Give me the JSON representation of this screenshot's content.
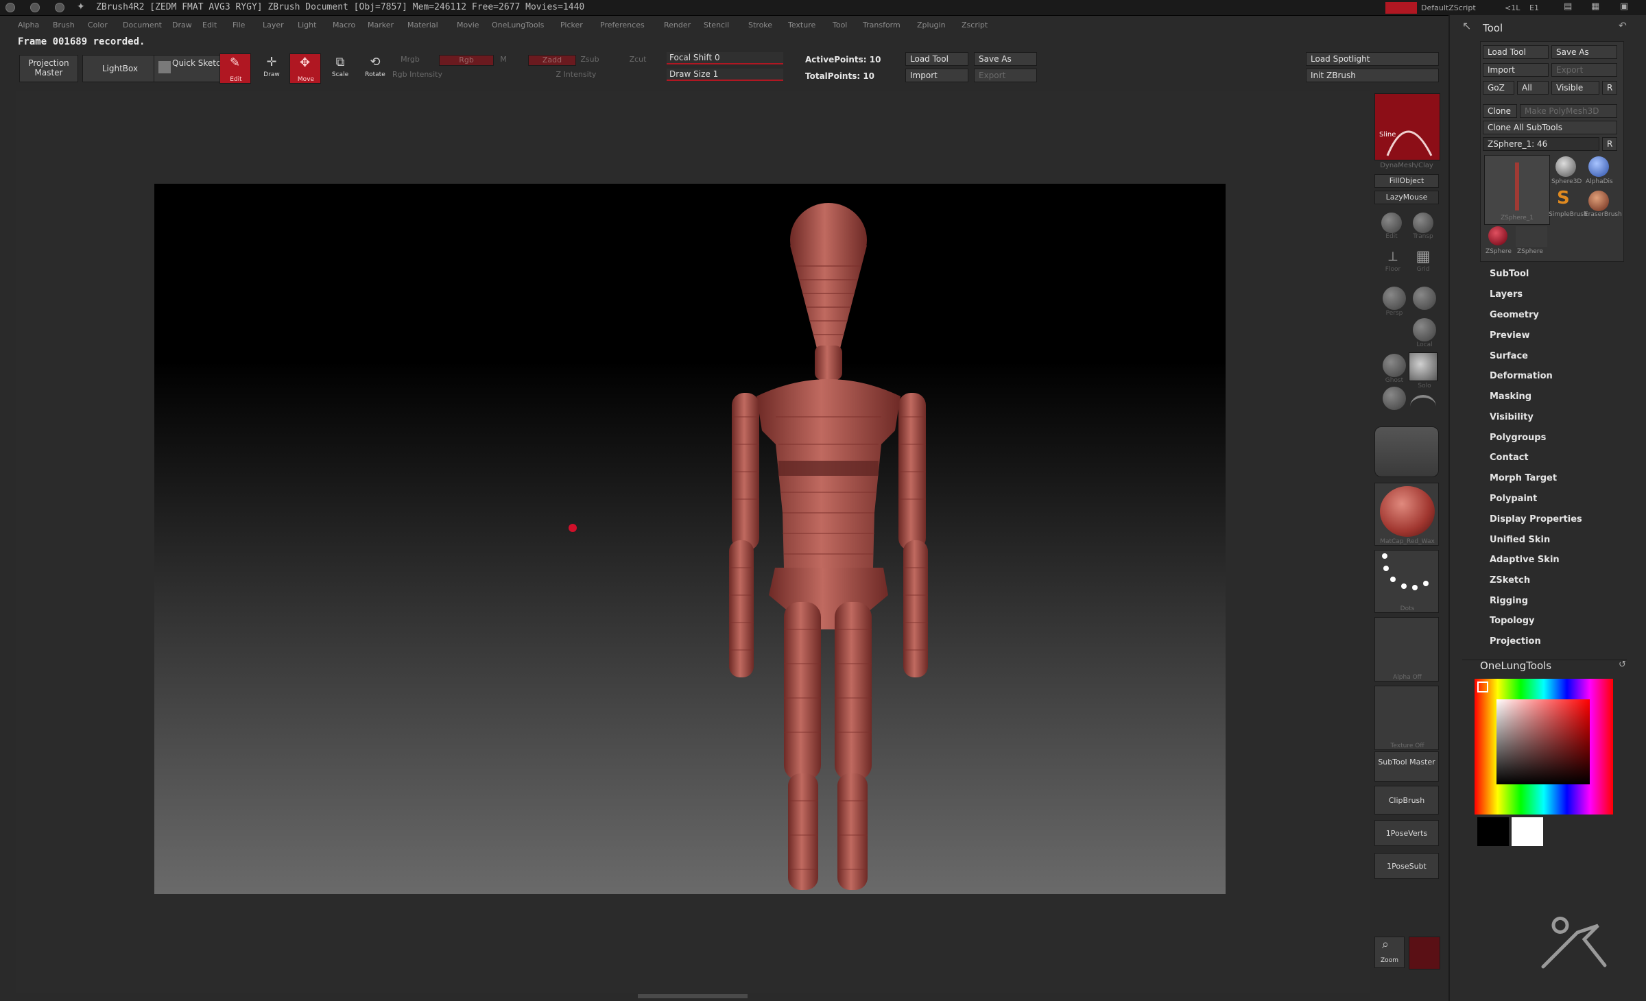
{
  "title_bar": {
    "title": "ZBrush4R2 [ZEDM FMAT AVG3 RYGY]    ZBrush Document    [Obj=7857] Mem=246112 Free=2677 Movies=1440",
    "right_red": "",
    "right_items": [
      "DefaultZScript",
      "<1L",
      "E1",
      "",
      ""
    ]
  },
  "menus": [
    "Alpha",
    "Brush",
    "Color",
    "Document",
    "Draw",
    "Edit",
    "File",
    "Layer",
    "Light",
    "Macro",
    "Marker",
    "Material",
    "Movie",
    "OneLungTools",
    "Picker",
    "Preferences",
    "Render",
    "Stencil",
    "Stroke",
    "Texture",
    "Tool",
    "Transform",
    "Zplugin",
    "Zscript"
  ],
  "status_message": "Frame 001689 recorded.",
  "toolbar": {
    "projection_master": "Projection Master",
    "lightbox": "LightBox",
    "quick_sketch": "Quick Sketch",
    "edit": "Edit",
    "draw": "Draw",
    "move": "Move",
    "scale": "Scale",
    "rotate": "Rotate",
    "mrgb": "Mrgb",
    "rgb": "Rgb",
    "m": "M",
    "zadd": "Zadd",
    "zsub": "Zsub",
    "zcut": "Zcut",
    "rgb_intensity": "Rgb Intensity",
    "z_intensity": "Z Intensity",
    "focal_shift": "Focal Shift 0",
    "draw_size": "Draw Size 1",
    "active_points": "ActivePoints: 10",
    "total_points": "TotalPoints: 10",
    "load_tool": "Load Tool",
    "save_as": "Save As",
    "import": "Import",
    "export": "Export",
    "load_spotlight": "Load Spotlight",
    "init_zbrush": "Init ZBrush"
  },
  "shelf": {
    "brush_label": "Sline",
    "dynamesh": "DynaMesh/Clay",
    "fill_object": "FillObject",
    "lazymouse": "LazyMouse",
    "icons": [
      "Edit",
      "Transp",
      "Floor",
      "Grid",
      "Persp",
      "Local",
      "Ghost",
      "Solo"
    ],
    "material_label": "MatCap_Red_Wax",
    "stroke_label": "Dots",
    "alpha_label": "Alpha Off",
    "texture_label": "Texture Off",
    "subtool_master": "SubTool Master",
    "clipbrush": "ClipBrush",
    "ipose_verts": "1PoseVerts",
    "ipose_subt": "1PoseSubt",
    "zoom": "Zoom",
    "material_color": "#b5584f"
  },
  "tool_panel": {
    "header": "Tool",
    "load_tool": "Load Tool",
    "save_as": "Save As",
    "import": "Import",
    "export": "Export",
    "goz": "GoZ",
    "all": "All",
    "visible": "Visible",
    "r": "R",
    "clone": "Clone",
    "make_polymesh": "Make PolyMesh3D",
    "clone_all": "Clone All SubTools",
    "zsphere": "ZSphere_1: 46",
    "thumbs": [
      "ZSphere_1",
      "Sphere3D",
      "AlphaDis",
      "SimpleBrush",
      "EraserBrush",
      "ZSphere",
      "ZSphere"
    ],
    "sections": [
      "SubTool",
      "Layers",
      "Geometry",
      "Preview",
      "Surface",
      "Deformation",
      "Masking",
      "Visibility",
      "Polygroups",
      "Contact",
      "Morph Target",
      "Polypaint",
      "Display Properties",
      "Unified Skin",
      "Adaptive Skin",
      "ZSketch",
      "Rigging",
      "Topology",
      "Projection"
    ],
    "onelung": "OneLungTools"
  },
  "colors": {
    "accent": "#b01722",
    "figure": "#b5584f",
    "panel": "#3a3a3a"
  }
}
